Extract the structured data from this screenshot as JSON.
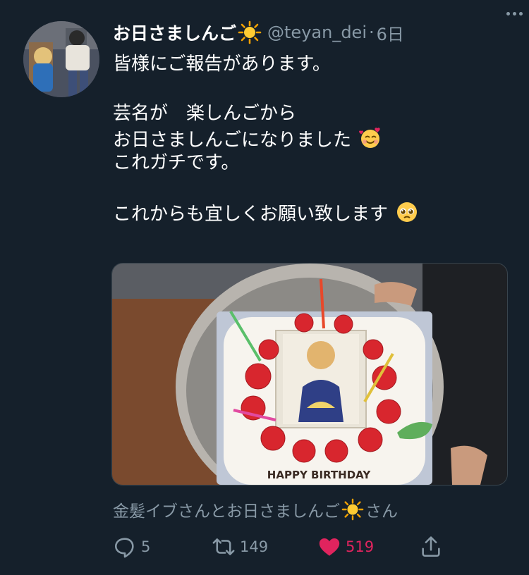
{
  "tweet": {
    "display_name": "お日さましんご",
    "handle": "@teyan_dei",
    "separator": "·",
    "time": "6日",
    "lines": [
      "皆様にご報告があります。",
      "",
      "芸名が　楽しんごから",
      "お日さましんごになりました",
      "これガチです。",
      "",
      "これからも宜しくお願い致します"
    ],
    "icons": {
      "name_badge": "sun-emoji",
      "line4_emoji": "smiling-face-with-hearts-emoji",
      "line7_emoji": "pleading-face-emoji"
    },
    "media": {
      "cake_text": "HAPPY BIRTHDAY"
    }
  },
  "social_context": {
    "prefix": "金髪イブさんとお日さましんご",
    "suffix": "さん"
  },
  "actions": {
    "reply": {
      "icon": "reply-icon",
      "count": "5"
    },
    "retweet": {
      "icon": "retweet-icon",
      "count": "149"
    },
    "like": {
      "icon": "heart-icon",
      "count": "519",
      "liked": true
    },
    "share": {
      "icon": "share-icon"
    }
  },
  "colors": {
    "background": "#15202b",
    "text": "#ffffff",
    "muted": "#8899a6",
    "like": "#e0245e"
  }
}
